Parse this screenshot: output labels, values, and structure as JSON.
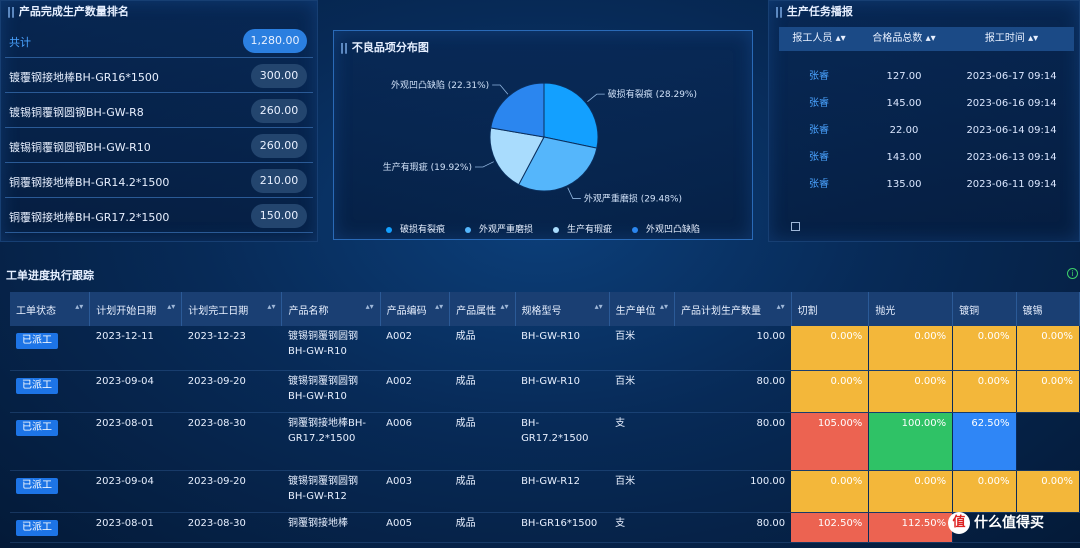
{
  "ranking": {
    "title": "产品完成生产数量排名",
    "items": [
      {
        "name": "共计",
        "value": "1,280.00"
      },
      {
        "name": "镀覆钢接地棒BH-GR16*1500",
        "value": "300.00"
      },
      {
        "name": "镀锡铜覆钢圆钢BH-GW-R8",
        "value": "260.00"
      },
      {
        "name": "镀锡铜覆钢圆钢BH-GW-R10",
        "value": "260.00"
      },
      {
        "name": "铜覆钢接地棒BH-GR14.2*1500",
        "value": "210.00"
      },
      {
        "name": "铜覆钢接地棒BH-GR17.2*1500",
        "value": "150.00"
      }
    ]
  },
  "pie": {
    "title": "不良品项分布图",
    "colors": [
      "#13a0ff",
      "#55b6fb",
      "#a9dcfd",
      "#2b86ef"
    ]
  },
  "chart_data": {
    "type": "pie",
    "title": "不良品项分布图",
    "slices": [
      {
        "name": "破损有裂痕",
        "value": 28.29,
        "label": "破损有裂痕 (28.29%)"
      },
      {
        "name": "外观严重磨损",
        "value": 29.48,
        "label": "外观严重磨损 (29.48%)"
      },
      {
        "name": "生产有瑕疵",
        "value": 19.92,
        "label": "生产有瑕疵 (19.92%)"
      },
      {
        "name": "外观凹凸缺陷",
        "value": 22.31,
        "label": "外观凹凸缺陷 (22.31%)"
      }
    ],
    "legend": [
      "破损有裂痕",
      "外观严重磨损",
      "生产有瑕疵",
      "外观凹凸缺陷"
    ],
    "legend_position": "bottom"
  },
  "report": {
    "title": "生产任务播报",
    "headers": [
      "报工人员",
      "合格品总数",
      "报工时间"
    ],
    "rows": [
      {
        "person": "张睿",
        "count": "127.00",
        "time": "2023-06-17 09:14"
      },
      {
        "person": "张睿",
        "count": "145.00",
        "time": "2023-06-16 09:14"
      },
      {
        "person": "张睿",
        "count": "22.00",
        "time": "2023-06-14 09:14"
      },
      {
        "person": "张睿",
        "count": "143.00",
        "time": "2023-06-13 09:14"
      },
      {
        "person": "张睿",
        "count": "135.00",
        "time": "2023-06-11 09:14"
      }
    ]
  },
  "workorders": {
    "title": "工单进度执行跟踪",
    "headers": [
      "工单状态",
      "计划开始日期",
      "计划完工日期",
      "产品名称",
      "产品编码",
      "产品属性",
      "规格型号",
      "生产单位",
      "产品计划生产数量",
      "切割",
      "抛光",
      "镀铜",
      "镀锡"
    ],
    "rows": [
      {
        "status": "已派工",
        "start": "2023-12-11",
        "end": "2023-12-23",
        "name": "镀锡铜覆钢圆钢BH-GW-R10",
        "code": "A002",
        "attr": "成品",
        "spec": "BH-GW-R10",
        "unit": "百米",
        "qty": "10.00",
        "cut": "0.00%",
        "polish": "0.00%",
        "copper": "0.00%",
        "tin": "0.00%"
      },
      {
        "status": "已派工",
        "start": "2023-09-04",
        "end": "2023-09-20",
        "name": "镀锡铜覆钢圆钢BH-GW-R10",
        "code": "A002",
        "attr": "成品",
        "spec": "BH-GW-R10",
        "unit": "百米",
        "qty": "80.00",
        "cut": "0.00%",
        "polish": "0.00%",
        "copper": "0.00%",
        "tin": "0.00%"
      },
      {
        "status": "已派工",
        "start": "2023-08-01",
        "end": "2023-08-30",
        "name": "铜覆钢接地棒BH-GR17.2*1500",
        "code": "A006",
        "attr": "成品",
        "spec": "BH-GR17.2*1500",
        "unit": "支",
        "qty": "80.00",
        "cut": "105.00%",
        "polish": "100.00%",
        "copper": "62.50%",
        "tin": ""
      },
      {
        "status": "已派工",
        "start": "2023-09-04",
        "end": "2023-09-20",
        "name": "镀锡铜覆钢圆钢BH-GW-R12",
        "code": "A003",
        "attr": "成品",
        "spec": "BH-GW-R12",
        "unit": "百米",
        "qty": "100.00",
        "cut": "0.00%",
        "polish": "0.00%",
        "copper": "0.00%",
        "tin": "0.00%"
      },
      {
        "status": "已派工",
        "start": "2023-08-01",
        "end": "2023-08-30",
        "name": "铜覆钢接地棒",
        "code": "A005",
        "attr": "成品",
        "spec": "BH-GR16*1500",
        "unit": "支",
        "qty": "80.00",
        "cut": "102.50%",
        "polish": "112.50%",
        "copper": "",
        "tin": ""
      }
    ]
  },
  "watermark": {
    "mark": "值",
    "text": "什么值得买"
  }
}
